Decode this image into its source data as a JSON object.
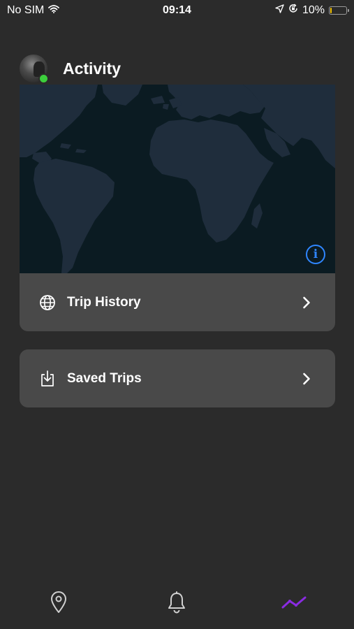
{
  "status_bar": {
    "carrier": "No SIM",
    "time": "09:14",
    "battery": "10%",
    "battery_level": 0.1,
    "icons": [
      "wifi-icon",
      "location-arrow-icon",
      "orientation-lock-icon",
      "battery-icon"
    ]
  },
  "header": {
    "title": "Activity",
    "avatar_status_color": "#3ccf3c"
  },
  "map": {
    "info_glyph": "i",
    "ocean_color": "#0b1b22",
    "land_color": "#1f2d3c",
    "accent_color": "#2f86ff"
  },
  "menu": {
    "items": [
      {
        "label": "Trip History",
        "icon": "globe-icon"
      },
      {
        "label": "Saved Trips",
        "icon": "download-tray-icon"
      }
    ]
  },
  "tab_bar": {
    "tabs": [
      {
        "name": "map",
        "icon": "map-pin-icon",
        "active": false
      },
      {
        "name": "alerts",
        "icon": "bell-icon",
        "active": false
      },
      {
        "name": "activity",
        "icon": "activity-line-icon",
        "active": true
      }
    ],
    "active_color": "#8a2be2",
    "inactive_color": "#d0d0d0"
  }
}
